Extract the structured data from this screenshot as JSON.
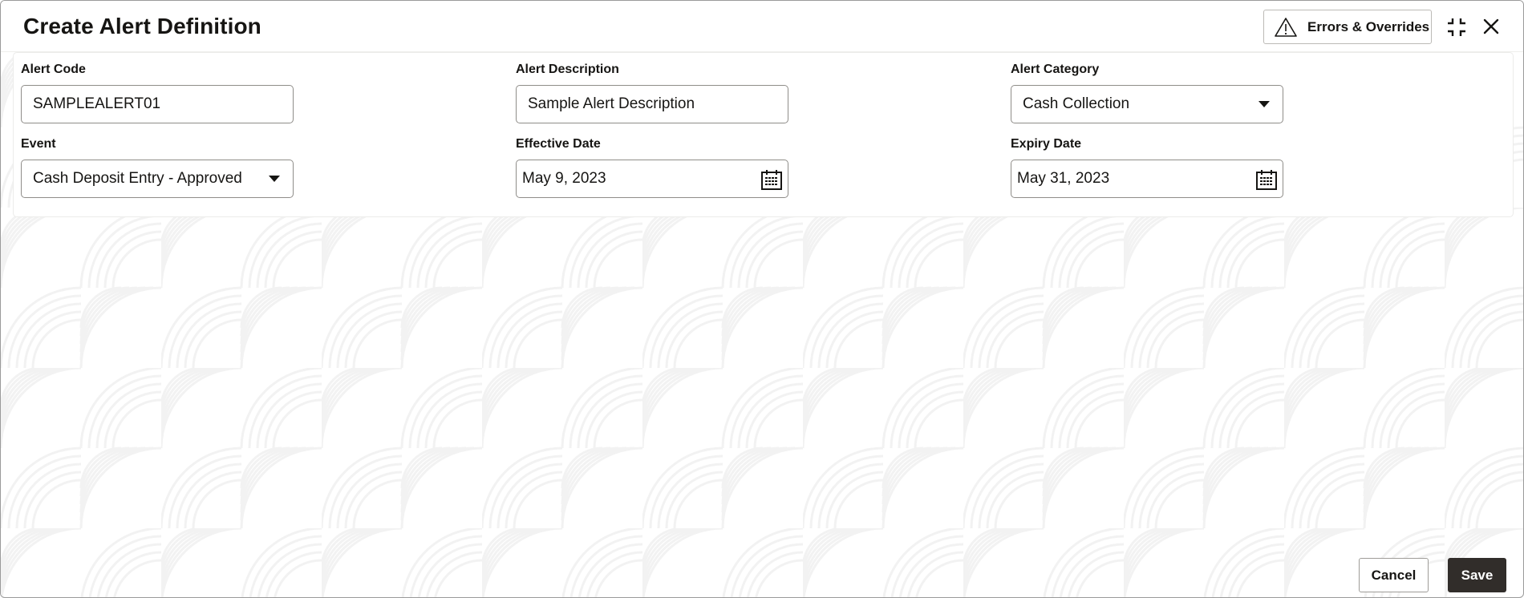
{
  "dialog": {
    "title": "Create Alert Definition",
    "errors_button_label": "Errors & Overrides",
    "icons": {
      "warning": "warning-triangle-icon",
      "collapse": "collapse-icon",
      "close": "close-icon"
    }
  },
  "form": {
    "fields": [
      {
        "label": "Alert Code",
        "type": "text",
        "value": "SAMPLEALERT01"
      },
      {
        "label": "Alert Description",
        "type": "text",
        "value": "Sample Alert Description"
      },
      {
        "label": "Alert Category",
        "type": "select",
        "value": "Cash Collection"
      },
      {
        "label": "Event",
        "type": "select",
        "value": "Cash Deposit Entry - Approved"
      },
      {
        "label": "Effective Date",
        "type": "date",
        "value": "May 9, 2023"
      },
      {
        "label": "Expiry Date",
        "type": "date",
        "value": "May 31, 2023"
      }
    ]
  },
  "footer": {
    "cancel_label": "Cancel",
    "save_label": "Save"
  },
  "colors": {
    "primary_button": "#312d2a",
    "text": "#161513",
    "input_border": "#8f8d89"
  }
}
